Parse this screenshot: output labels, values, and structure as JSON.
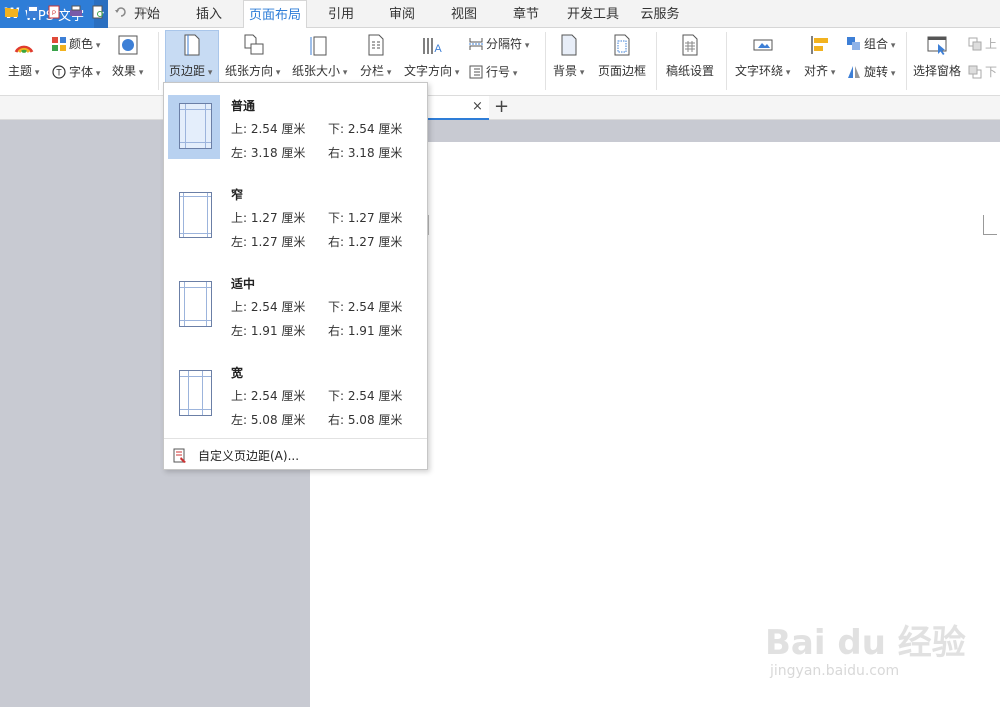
{
  "app": {
    "title": "WPS 文字",
    "logo": "W"
  },
  "tabs": [
    "开始",
    "插入",
    "页面布局",
    "引用",
    "审阅",
    "视图",
    "章节",
    "开发工具",
    "云服务"
  ],
  "ribbon": {
    "theme": "主题",
    "color": "颜色",
    "font": "字体",
    "effect": "效果",
    "margins": "页边距",
    "orientation": "纸张方向",
    "size": "纸张大小",
    "columns": "分栏",
    "text_direction": "文字方向",
    "breaks": "分隔符",
    "line_numbers": "行号",
    "background": "背景",
    "page_border": "页面边框",
    "manuscript": "稿纸设置",
    "wrap": "文字环绕",
    "align": "对齐",
    "group": "组合",
    "rotate": "旋转",
    "selection_pane": "选择窗格",
    "bring_forward": "上",
    "send_backward": "下"
  },
  "margin_menu": {
    "options": [
      {
        "title": "普通",
        "top": "上: 2.54 厘米",
        "bottom": "下: 2.54 厘米",
        "left": "左: 3.18 厘米",
        "right": "右: 3.18 厘米"
      },
      {
        "title": "窄",
        "top": "上: 1.27 厘米",
        "bottom": "下: 1.27 厘米",
        "left": "左: 1.27 厘米",
        "right": "右: 1.27 厘米"
      },
      {
        "title": "适中",
        "top": "上: 2.54 厘米",
        "bottom": "下: 2.54 厘米",
        "left": "左: 1.91 厘米",
        "right": "右: 1.91 厘米"
      },
      {
        "title": "宽",
        "top": "上: 2.54 厘米",
        "bottom": "下: 2.54 厘米",
        "left": "左: 5.08 厘米",
        "right": "右: 5.08 厘米"
      }
    ],
    "custom": "自定义页边距(A)..."
  },
  "doc_tabs": {
    "close": "×",
    "add": "+"
  },
  "watermark": {
    "brand": "Bai du 经验",
    "url": "jingyan.baidu.com"
  },
  "colors": {
    "accent": "#2e7dd7",
    "selected": "#c7dbf3",
    "canvas": "#c8cad2"
  }
}
